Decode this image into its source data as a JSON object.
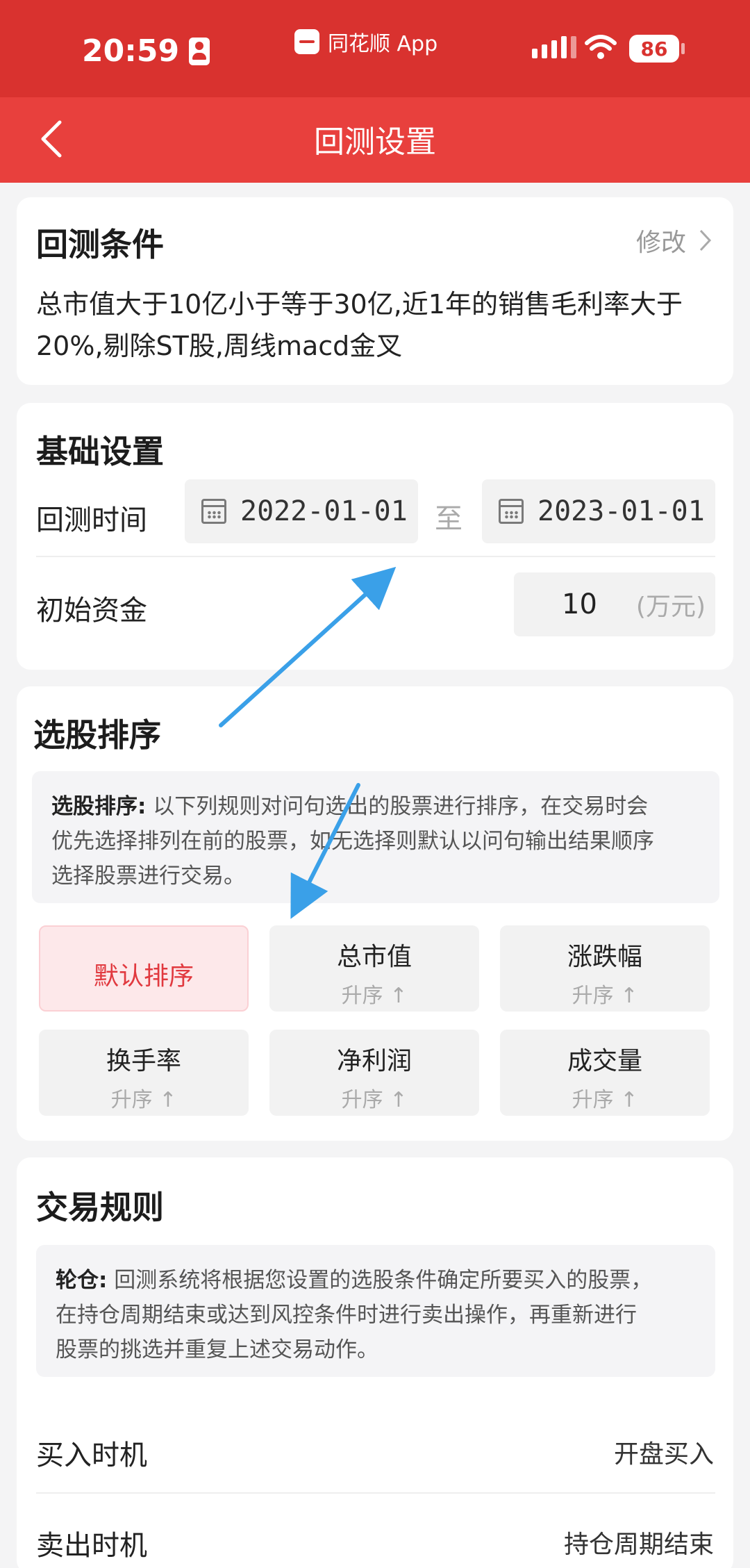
{
  "status_bar": {
    "time": "20:59",
    "app_name": "同花顺 App",
    "battery": "86"
  },
  "nav": {
    "title": "回测设置"
  },
  "conditions": {
    "heading": "回测条件",
    "edit_label": "修改",
    "line1": "总市值大于10亿小于等于30亿,近1年的销售毛利率大于",
    "line2": "20%,剔除ST股,周线macd金叉"
  },
  "basic": {
    "heading": "基础设置",
    "time_label": "回测时间",
    "start_date": "2022-01-01",
    "to_label": "至",
    "end_date": "2023-01-01",
    "capital_label": "初始资金",
    "capital_value": "10",
    "capital_unit": "(万元)"
  },
  "sorting": {
    "heading": "选股排序",
    "note_label": "选股排序:",
    "note_line1": "以下列规则对问句选出的股票进行排序，在交易时会",
    "note_line2": "优先选择排列在前的股票，如无选择则默认以问句输出结果顺序",
    "note_line3": "选择股票进行交易。",
    "options": [
      {
        "name": "默认排序",
        "sub": ""
      },
      {
        "name": "总市值",
        "sub": "升序 ↑"
      },
      {
        "name": "涨跌幅",
        "sub": "升序 ↑"
      },
      {
        "name": "换手率",
        "sub": "升序 ↑"
      },
      {
        "name": "净利润",
        "sub": "升序 ↑"
      },
      {
        "name": "成交量",
        "sub": "升序 ↑"
      }
    ]
  },
  "trade": {
    "heading": "交易规则",
    "note_label": "轮仓:",
    "note_line1": "回测系统将根据您设置的选股条件确定所要买入的股票，",
    "note_line2": "在持仓周期结束或达到风控条件时进行卖出操作，再重新进行",
    "note_line3": "股票的挑选并重复上述交易动作。",
    "buy_label": "买入时机",
    "buy_value": "开盘买入",
    "sell_label": "卖出时机",
    "sell_value": "持仓周期结束"
  },
  "colors": {
    "brand_red": "#e8403d",
    "arrow_blue": "#3aa0e8"
  }
}
